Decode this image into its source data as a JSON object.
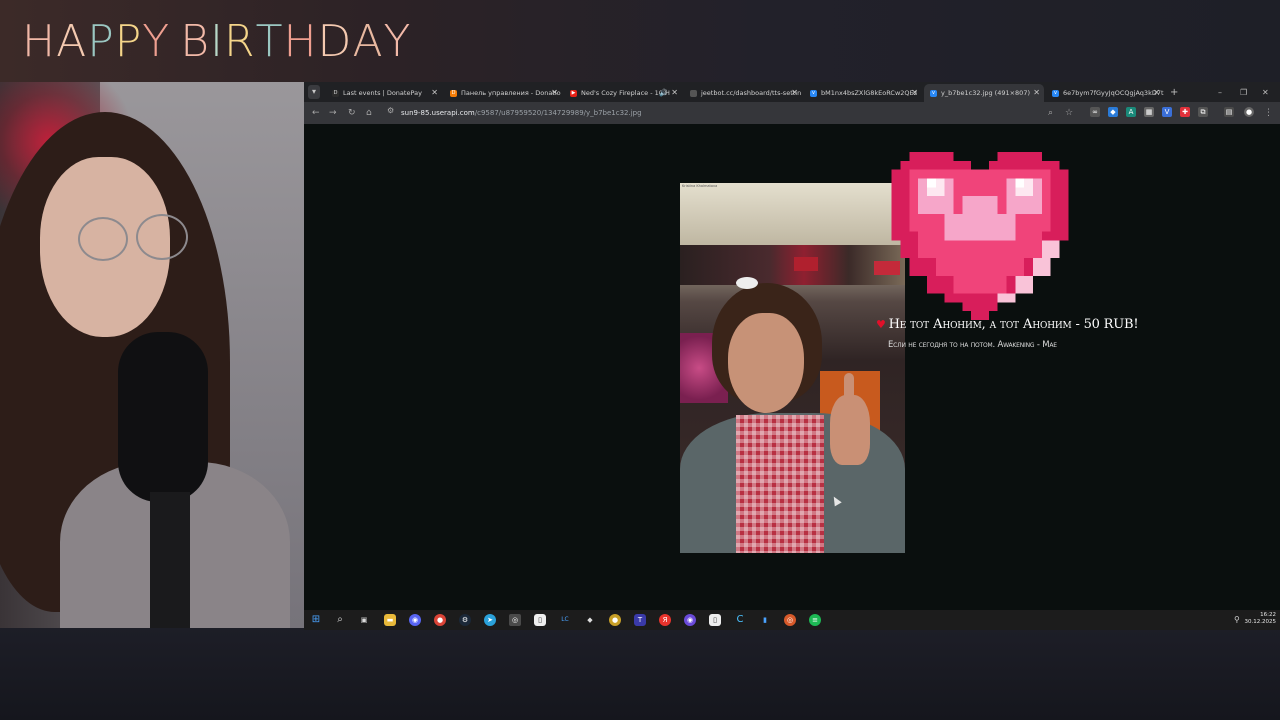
{
  "overlay": {
    "banner_title": "HAPPY BIRTHDAY",
    "banner_letters": [
      "H",
      "A",
      "P",
      "P",
      "Y",
      " ",
      "B",
      "I",
      "R",
      "T",
      "H",
      "D",
      "A",
      "Y"
    ]
  },
  "browser": {
    "tabs": [
      {
        "label": "Last events | DonatePay",
        "icon": "donatepay-icon",
        "active": false
      },
      {
        "label": "Панель управления - Donatio",
        "icon": "donationalerts-icon",
        "active": false
      },
      {
        "label": "Ned's Cozy Fireplace - 10 H",
        "icon": "youtube-icon",
        "active": false,
        "audio": true
      },
      {
        "label": "jeetbot.cc/dashboard/tts-settin",
        "icon": "page-icon",
        "active": false
      },
      {
        "label": "bM1nx4bsZXlG8kEoRCw2QEz",
        "icon": "vk-icon",
        "active": false
      },
      {
        "label": "y_b7be1c32.jpg (491×807)",
        "icon": "vk-icon",
        "active": true
      },
      {
        "label": "6e7bym7fGyyJqOCQgjAq3kD7t",
        "icon": "vk-icon",
        "active": false
      }
    ],
    "address": {
      "host": "sun9-85.userapi.com",
      "path": "/c9587/u87959520/134729989/y_b7be1c32.jpg"
    }
  },
  "alert": {
    "title": "Не тот Аноним, а тот Аноним - 50 RUB!",
    "message": "Если не сегодня то на потом. Awakening - Mae"
  },
  "photo": {
    "caption": "Kristina Khalmatova"
  },
  "taskbar": {
    "time": "16:22",
    "date": "30.12.2025"
  },
  "colors": {
    "tab_bar": "#202124",
    "active_tab": "#35363a",
    "page_bg": "#0a0f0e",
    "heart_pink": "#f0447a",
    "alert_heart": "#e0102a"
  }
}
